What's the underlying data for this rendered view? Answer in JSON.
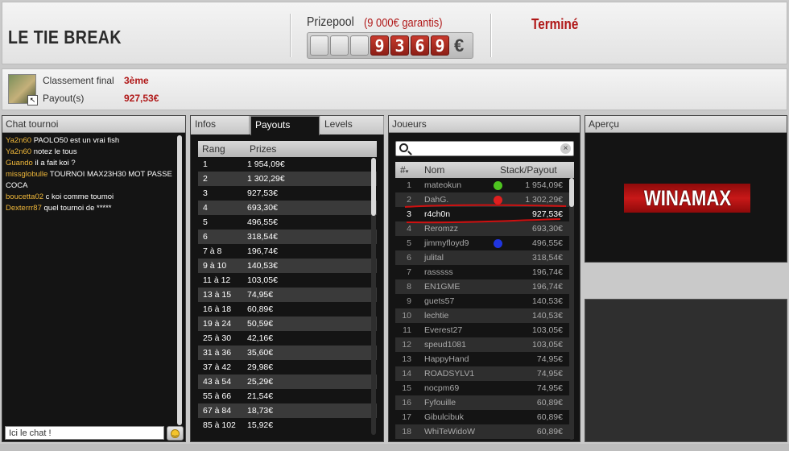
{
  "header": {
    "title": "LE TIE BREAK",
    "prizepool_label": "Prizepool",
    "prizepool_guarantee": "(9 000€ garantis)",
    "prizepool_digits": [
      "",
      "",
      "",
      "9",
      "3",
      "6",
      "9"
    ],
    "currency": "€",
    "status": "Terminé"
  },
  "result": {
    "rank_label": "Classement final",
    "rank_value": "3ème",
    "payout_label": "Payout(s)",
    "payout_value": "927,53€"
  },
  "chat": {
    "title": "Chat tournoi",
    "messages": [
      {
        "nick": "Ya2n60",
        "text": "PAOLO50 est un vrai fish"
      },
      {
        "nick": "Ya2n60",
        "text": "notez le tous"
      },
      {
        "nick": "Guando",
        "text": "il a fait koi ?"
      },
      {
        "nick": "missglobulle",
        "text": "TOURNOI MAX23H30 MOT PASSE COCA"
      },
      {
        "nick": "boucetta02",
        "text": "c koi comme toumoi"
      },
      {
        "nick": "Dexterrr87",
        "text": "quel tournoi de *****"
      }
    ],
    "input_value": "Ici le chat !"
  },
  "payouts": {
    "tabs": [
      "Infos",
      "Payouts",
      "Levels"
    ],
    "active_tab": "Payouts",
    "columns": [
      "Rang",
      "Prizes"
    ],
    "rows": [
      [
        "1",
        "1 954,09€"
      ],
      [
        "2",
        "1 302,29€"
      ],
      [
        "3",
        "927,53€"
      ],
      [
        "4",
        "693,30€"
      ],
      [
        "5",
        "496,55€"
      ],
      [
        "6",
        "318,54€"
      ],
      [
        "7 à 8",
        "196,74€"
      ],
      [
        "9 à 10",
        "140,53€"
      ],
      [
        "11 à 12",
        "103,05€"
      ],
      [
        "13 à 15",
        "74,95€"
      ],
      [
        "16 à 18",
        "60,89€"
      ],
      [
        "19 à 24",
        "50,59€"
      ],
      [
        "25 à 30",
        "42,16€"
      ],
      [
        "31 à 36",
        "35,60€"
      ],
      [
        "37 à 42",
        "29,98€"
      ],
      [
        "43 à 54",
        "25,29€"
      ],
      [
        "55 à 66",
        "21,54€"
      ],
      [
        "67 à 84",
        "18,73€"
      ],
      [
        "85 à 102",
        "15,92€"
      ]
    ]
  },
  "players": {
    "title": "Joueurs",
    "search_value": "",
    "columns": [
      "#",
      "Nom",
      "Stack/Payout"
    ],
    "rows": [
      {
        "n": "1",
        "name": "mateokun",
        "dot": "#4ec420",
        "payout": "1 954,09€"
      },
      {
        "n": "2",
        "name": "DahG.",
        "dot": "#e01f1f",
        "payout": "1 302,29€"
      },
      {
        "n": "3",
        "name": "r4ch0n",
        "dot": "",
        "payout": "927,53€",
        "me": true
      },
      {
        "n": "4",
        "name": "Reromzz",
        "dot": "",
        "payout": "693,30€"
      },
      {
        "n": "5",
        "name": "jimmyfloyd9",
        "dot": "#2035e0",
        "payout": "496,55€"
      },
      {
        "n": "6",
        "name": "julital",
        "dot": "",
        "payout": "318,54€"
      },
      {
        "n": "7",
        "name": "rasssss",
        "dot": "",
        "payout": "196,74€"
      },
      {
        "n": "8",
        "name": "EN1GME",
        "dot": "",
        "payout": "196,74€"
      },
      {
        "n": "9",
        "name": "guets57",
        "dot": "",
        "payout": "140,53€"
      },
      {
        "n": "10",
        "name": "lechtie",
        "dot": "",
        "payout": "140,53€"
      },
      {
        "n": "11",
        "name": "Everest27",
        "dot": "",
        "payout": "103,05€"
      },
      {
        "n": "12",
        "name": "speud1081",
        "dot": "",
        "payout": "103,05€"
      },
      {
        "n": "13",
        "name": "HappyHand",
        "dot": "",
        "payout": "74,95€"
      },
      {
        "n": "14",
        "name": "ROADSYLV1",
        "dot": "",
        "payout": "74,95€"
      },
      {
        "n": "15",
        "name": "nocpm69",
        "dot": "",
        "payout": "74,95€"
      },
      {
        "n": "16",
        "name": "Fyfouille",
        "dot": "",
        "payout": "60,89€"
      },
      {
        "n": "17",
        "name": "Gibulcibuk",
        "dot": "",
        "payout": "60,89€"
      },
      {
        "n": "18",
        "name": "WhiTeWidoW",
        "dot": "",
        "payout": "60,89€"
      }
    ]
  },
  "apercu": {
    "title": "Aperçu",
    "logo_text": "WINAMAX"
  }
}
